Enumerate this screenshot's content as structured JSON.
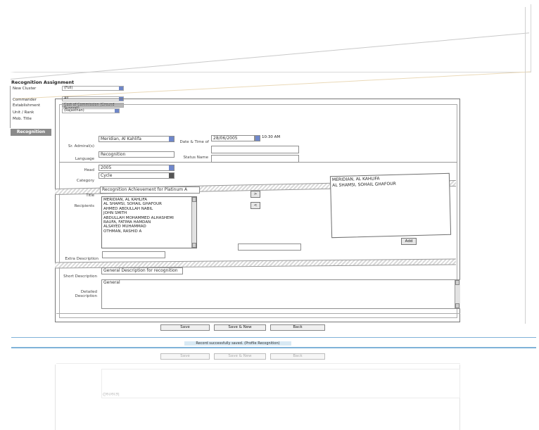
{
  "filter": {
    "title": "Recognition Assignment",
    "fields": [
      {
        "label": "New Cluster",
        "value": "(Full)"
      },
      {
        "label": "Commander",
        "value": "All"
      },
      {
        "label": "Establishment",
        "value": "Cost of Commission (Ground Support)"
      },
      {
        "label": "Unit / Rank",
        "value": "(Rajasthan)"
      },
      {
        "label": "Mob. Title",
        "value": ""
      }
    ],
    "tab_label": "Recognition"
  },
  "form": {
    "row1": {
      "label": "Sr. Admiral(s)",
      "value": "Meridian, Al Kahlifa",
      "date_label": "Date & Time of",
      "date_value": "28/06/2005",
      "time_value": "10:30 AM"
    },
    "row2": {
      "label": "Language",
      "value": "Recognition",
      "status_label": "Status Name",
      "status_value": ""
    },
    "row3": {
      "label": "Head",
      "value": "2005"
    },
    "row4": {
      "label": "Category",
      "value": "Cycle"
    },
    "title_field": {
      "label": "Title",
      "value": "Recognition Achievement for Platinum A"
    },
    "recipients_label": "Recipients",
    "available_list": [
      "MERIDIAN, AL KAHLIFA",
      "AL SHAMSI, SOHAIL GHAFOUR",
      "AHMED ABDULLAH NABIL",
      "JOHN SMITH",
      "ABDULLAH MOHAMMED ALHASHEMI",
      "RAUFA, FATIMA HAMDAN",
      "ALSAYED MUHAMMAD",
      "OTHMAN, RASHID A"
    ],
    "selected_list": [
      "MERIDIAN, AL KAHLIFA",
      "AL SHAMSI, SOHAIL GHAFOUR"
    ],
    "move_right": ">",
    "move_left": "<",
    "add_button": "Add",
    "extra_label": "Extra Description",
    "short_desc": {
      "label": "Short Description",
      "value": "General Description for recognition"
    },
    "detailed_desc": {
      "label": "Detailed Description",
      "value": "General"
    }
  },
  "buttons": {
    "save": "Save",
    "save_new": "Save & New",
    "back": "Back"
  },
  "status_text": "Record successfully saved. (Profile Recognition)"
}
